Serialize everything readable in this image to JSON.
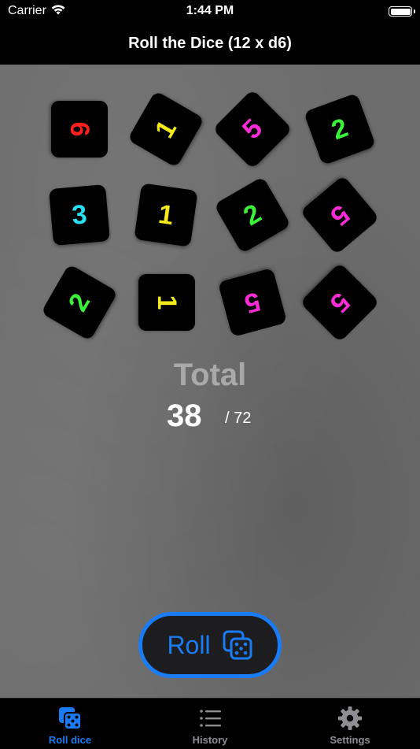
{
  "status_bar": {
    "carrier": "Carrier",
    "time": "1:44 PM"
  },
  "nav": {
    "title": "Roll the Dice (12 x d6)"
  },
  "dice": [
    {
      "value": "6",
      "color": "#ff1f1f",
      "rotation": 90
    },
    {
      "value": "1",
      "color": "#f4ea1a",
      "rotation": -60
    },
    {
      "value": "5",
      "color": "#ff2bd6",
      "rotation": -45
    },
    {
      "value": "2",
      "color": "#39f23a",
      "rotation": -20
    },
    {
      "value": "3",
      "color": "#26e0f4",
      "rotation": -5
    },
    {
      "value": "1",
      "color": "#f4ea1a",
      "rotation": 8
    },
    {
      "value": "2",
      "color": "#39f23a",
      "rotation": -30
    },
    {
      "value": "5",
      "color": "#ff2bd6",
      "rotation": 140
    },
    {
      "value": "2",
      "color": "#39f23a",
      "rotation": -60
    },
    {
      "value": "1",
      "color": "#f4ea1a",
      "rotation": 90
    },
    {
      "value": "5",
      "color": "#ff2bd6",
      "rotation": 165
    },
    {
      "value": "5",
      "color": "#ff2bd6",
      "rotation": 135
    }
  ],
  "result": {
    "label": "Total",
    "value": "38",
    "max": "/ 72"
  },
  "roll_button": {
    "label": "Roll",
    "icon": "dice-icon"
  },
  "tabs": [
    {
      "label": "Roll dice",
      "icon": "dice-icon",
      "active": true
    },
    {
      "label": "History",
      "icon": "list-icon",
      "active": false
    },
    {
      "label": "Settings",
      "icon": "gear-icon",
      "active": false
    }
  ],
  "colors": {
    "accent": "#1a7cf5",
    "inactive": "#8e8e93"
  }
}
